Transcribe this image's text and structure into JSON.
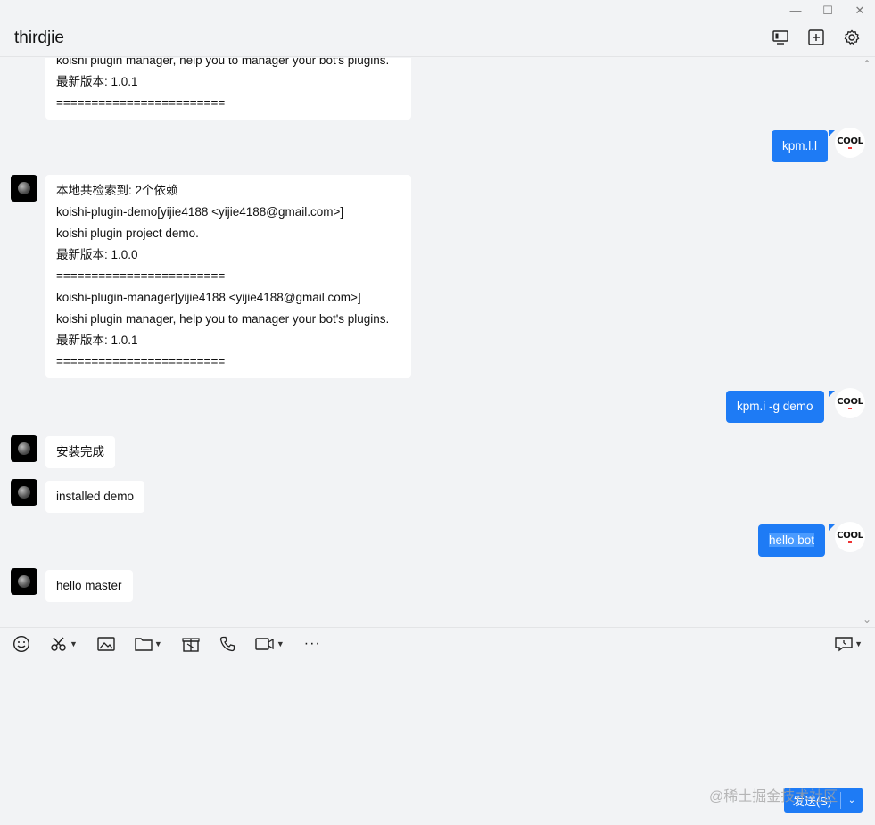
{
  "window": {
    "controls": {
      "minimize": "—",
      "maximize": "☐",
      "close": "✕"
    }
  },
  "header": {
    "title": "thirdjie",
    "icons": [
      "screen-share-icon",
      "add-member-icon",
      "settings-icon"
    ]
  },
  "avatars": {
    "me_label": "COOL"
  },
  "messages": {
    "m0": {
      "line1": "koishi plugin manager, help you to manager your bot's plugins.",
      "line2": "最新版本: 1.0.1",
      "line3": "========================"
    },
    "m1": {
      "text": "kpm.l.l"
    },
    "m2": {
      "lines": [
        "本地共检索到: 2个依赖",
        "koishi-plugin-demo[yijie4188 <yijie4188@gmail.com>]",
        "koishi plugin project demo.",
        "最新版本: 1.0.0",
        "========================",
        "koishi-plugin-manager[yijie4188 <yijie4188@gmail.com>]",
        "koishi plugin manager, help you to manager your bot's plugins.",
        "最新版本: 1.0.1",
        "========================"
      ]
    },
    "m3": {
      "text": "kpm.i -g demo"
    },
    "m4": {
      "text": "安装完成"
    },
    "m5": {
      "text": "installed demo"
    },
    "m6": {
      "text": "hello bot"
    },
    "m7": {
      "text": "hello master"
    }
  },
  "toolbar": {
    "tools": [
      "emoji-icon",
      "scissors-icon",
      "image-icon",
      "folder-icon",
      "gift-icon",
      "phone-icon",
      "video-icon",
      "more-icon"
    ],
    "more_label": "···"
  },
  "send": {
    "label": "发送(S)",
    "dropdown": "⌄"
  },
  "watermark": "@稀土掘金技术社区",
  "colors": {
    "accent": "#1e7bf5",
    "background": "#f2f3f5",
    "bubble_bot": "#ffffff"
  }
}
